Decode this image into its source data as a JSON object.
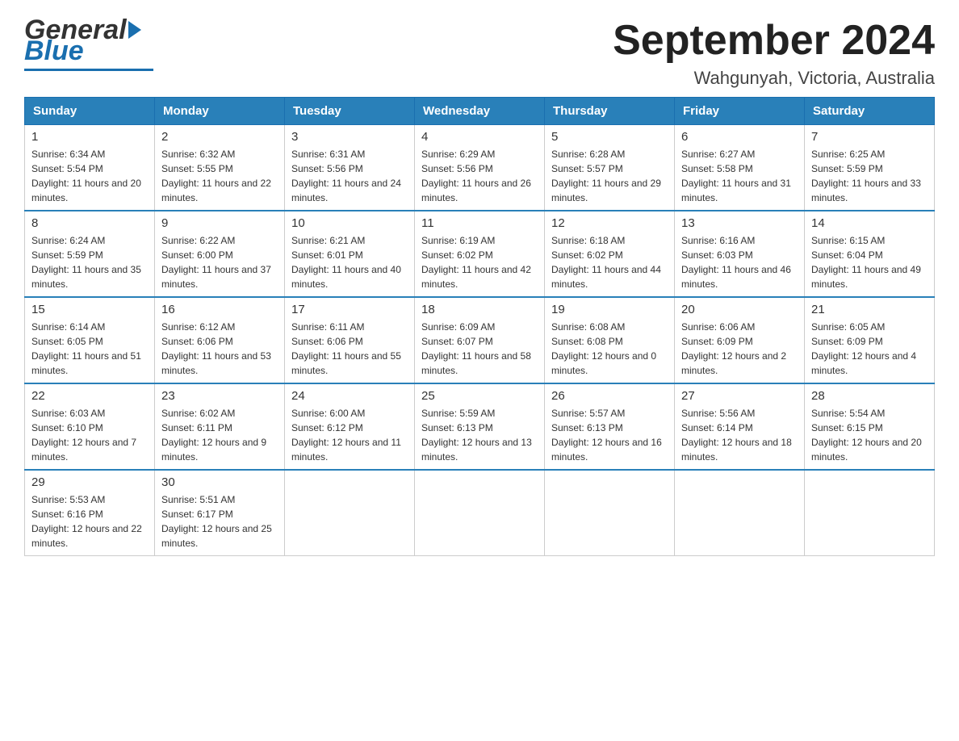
{
  "header": {
    "logo_general": "General",
    "logo_blue": "Blue",
    "month_title": "September 2024",
    "location": "Wahgunyah, Victoria, Australia"
  },
  "days": [
    "Sunday",
    "Monday",
    "Tuesday",
    "Wednesday",
    "Thursday",
    "Friday",
    "Saturday"
  ],
  "weeks": [
    [
      {
        "num": "1",
        "sunrise": "6:34 AM",
        "sunset": "5:54 PM",
        "daylight": "11 hours and 20 minutes."
      },
      {
        "num": "2",
        "sunrise": "6:32 AM",
        "sunset": "5:55 PM",
        "daylight": "11 hours and 22 minutes."
      },
      {
        "num": "3",
        "sunrise": "6:31 AM",
        "sunset": "5:56 PM",
        "daylight": "11 hours and 24 minutes."
      },
      {
        "num": "4",
        "sunrise": "6:29 AM",
        "sunset": "5:56 PM",
        "daylight": "11 hours and 26 minutes."
      },
      {
        "num": "5",
        "sunrise": "6:28 AM",
        "sunset": "5:57 PM",
        "daylight": "11 hours and 29 minutes."
      },
      {
        "num": "6",
        "sunrise": "6:27 AM",
        "sunset": "5:58 PM",
        "daylight": "11 hours and 31 minutes."
      },
      {
        "num": "7",
        "sunrise": "6:25 AM",
        "sunset": "5:59 PM",
        "daylight": "11 hours and 33 minutes."
      }
    ],
    [
      {
        "num": "8",
        "sunrise": "6:24 AM",
        "sunset": "5:59 PM",
        "daylight": "11 hours and 35 minutes."
      },
      {
        "num": "9",
        "sunrise": "6:22 AM",
        "sunset": "6:00 PM",
        "daylight": "11 hours and 37 minutes."
      },
      {
        "num": "10",
        "sunrise": "6:21 AM",
        "sunset": "6:01 PM",
        "daylight": "11 hours and 40 minutes."
      },
      {
        "num": "11",
        "sunrise": "6:19 AM",
        "sunset": "6:02 PM",
        "daylight": "11 hours and 42 minutes."
      },
      {
        "num": "12",
        "sunrise": "6:18 AM",
        "sunset": "6:02 PM",
        "daylight": "11 hours and 44 minutes."
      },
      {
        "num": "13",
        "sunrise": "6:16 AM",
        "sunset": "6:03 PM",
        "daylight": "11 hours and 46 minutes."
      },
      {
        "num": "14",
        "sunrise": "6:15 AM",
        "sunset": "6:04 PM",
        "daylight": "11 hours and 49 minutes."
      }
    ],
    [
      {
        "num": "15",
        "sunrise": "6:14 AM",
        "sunset": "6:05 PM",
        "daylight": "11 hours and 51 minutes."
      },
      {
        "num": "16",
        "sunrise": "6:12 AM",
        "sunset": "6:06 PM",
        "daylight": "11 hours and 53 minutes."
      },
      {
        "num": "17",
        "sunrise": "6:11 AM",
        "sunset": "6:06 PM",
        "daylight": "11 hours and 55 minutes."
      },
      {
        "num": "18",
        "sunrise": "6:09 AM",
        "sunset": "6:07 PM",
        "daylight": "11 hours and 58 minutes."
      },
      {
        "num": "19",
        "sunrise": "6:08 AM",
        "sunset": "6:08 PM",
        "daylight": "12 hours and 0 minutes."
      },
      {
        "num": "20",
        "sunrise": "6:06 AM",
        "sunset": "6:09 PM",
        "daylight": "12 hours and 2 minutes."
      },
      {
        "num": "21",
        "sunrise": "6:05 AM",
        "sunset": "6:09 PM",
        "daylight": "12 hours and 4 minutes."
      }
    ],
    [
      {
        "num": "22",
        "sunrise": "6:03 AM",
        "sunset": "6:10 PM",
        "daylight": "12 hours and 7 minutes."
      },
      {
        "num": "23",
        "sunrise": "6:02 AM",
        "sunset": "6:11 PM",
        "daylight": "12 hours and 9 minutes."
      },
      {
        "num": "24",
        "sunrise": "6:00 AM",
        "sunset": "6:12 PM",
        "daylight": "12 hours and 11 minutes."
      },
      {
        "num": "25",
        "sunrise": "5:59 AM",
        "sunset": "6:13 PM",
        "daylight": "12 hours and 13 minutes."
      },
      {
        "num": "26",
        "sunrise": "5:57 AM",
        "sunset": "6:13 PM",
        "daylight": "12 hours and 16 minutes."
      },
      {
        "num": "27",
        "sunrise": "5:56 AM",
        "sunset": "6:14 PM",
        "daylight": "12 hours and 18 minutes."
      },
      {
        "num": "28",
        "sunrise": "5:54 AM",
        "sunset": "6:15 PM",
        "daylight": "12 hours and 20 minutes."
      }
    ],
    [
      {
        "num": "29",
        "sunrise": "5:53 AM",
        "sunset": "6:16 PM",
        "daylight": "12 hours and 22 minutes."
      },
      {
        "num": "30",
        "sunrise": "5:51 AM",
        "sunset": "6:17 PM",
        "daylight": "12 hours and 25 minutes."
      },
      null,
      null,
      null,
      null,
      null
    ]
  ],
  "labels": {
    "sunrise": "Sunrise:",
    "sunset": "Sunset:",
    "daylight": "Daylight:"
  }
}
